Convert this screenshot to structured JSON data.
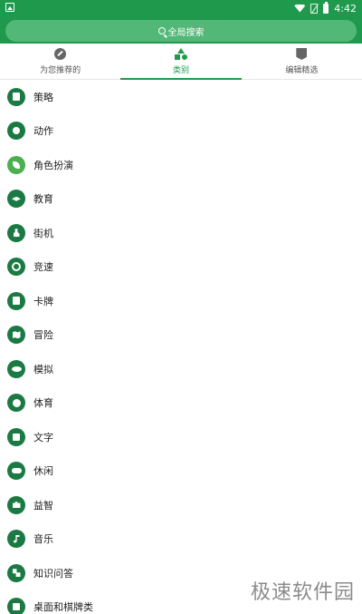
{
  "status_bar": {
    "time": "4:42"
  },
  "search": {
    "label": "全局搜索",
    "icon": "search-icon"
  },
  "tabs": [
    {
      "label": "为您推荐的",
      "icon": "compass-icon",
      "active": false
    },
    {
      "label": "类别",
      "icon": "categories-icon",
      "active": true
    },
    {
      "label": "编辑精选",
      "icon": "editors-choice-icon",
      "active": false
    }
  ],
  "categories": [
    {
      "label": "策略",
      "icon": "chess-icon"
    },
    {
      "label": "动作",
      "icon": "action-icon"
    },
    {
      "label": "角色扮演",
      "icon": "leaf-icon"
    },
    {
      "label": "教育",
      "icon": "graduation-cap-icon"
    },
    {
      "label": "街机",
      "icon": "arcade-icon"
    },
    {
      "label": "竞速",
      "icon": "steering-wheel-icon"
    },
    {
      "label": "卡牌",
      "icon": "card-icon"
    },
    {
      "label": "冒险",
      "icon": "map-icon"
    },
    {
      "label": "模拟",
      "icon": "eye-icon"
    },
    {
      "label": "体育",
      "icon": "ball-icon"
    },
    {
      "label": "文字",
      "icon": "text-icon"
    },
    {
      "label": "休闲",
      "icon": "gamepad-icon"
    },
    {
      "label": "益智",
      "icon": "puzzle-icon"
    },
    {
      "label": "音乐",
      "icon": "music-note-icon"
    },
    {
      "label": "知识问答",
      "icon": "quiz-icon"
    },
    {
      "label": "桌面和棋牌类",
      "icon": "dice-icon"
    }
  ],
  "watermark": "极速软件园",
  "colors": {
    "primary": "#1f9a4c",
    "icon_bg": "#1b7a43"
  }
}
